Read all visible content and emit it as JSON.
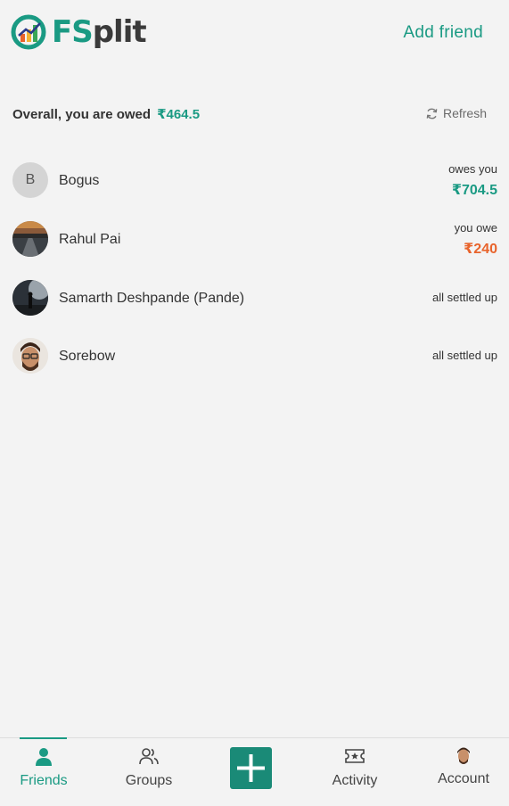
{
  "app": {
    "logo_text_a": "FS",
    "logo_text_b": "plit",
    "brand_color": "#1a9a83",
    "add_friend_label": "Add friend"
  },
  "summary": {
    "label": "Overall, you are owed",
    "amount": "₹464.5",
    "refresh_label": "Refresh"
  },
  "friends": [
    {
      "name": "Bogus",
      "initial": "B",
      "status_label": "owes you",
      "amount": "₹704.5",
      "kind": "owed"
    },
    {
      "name": "Rahul Pai",
      "status_label": "you owe",
      "amount": "₹240",
      "kind": "owe"
    },
    {
      "name": "Samarth Deshpande (Pande)",
      "status_label": "all settled up",
      "amount": "",
      "kind": "settled"
    },
    {
      "name": "Sorebow",
      "status_label": "all settled up",
      "amount": "",
      "kind": "settled"
    }
  ],
  "nav": {
    "friends": "Friends",
    "groups": "Groups",
    "activity": "Activity",
    "account": "Account"
  },
  "colors": {
    "owed": "#1a9a83",
    "owe": "#e8632b"
  }
}
